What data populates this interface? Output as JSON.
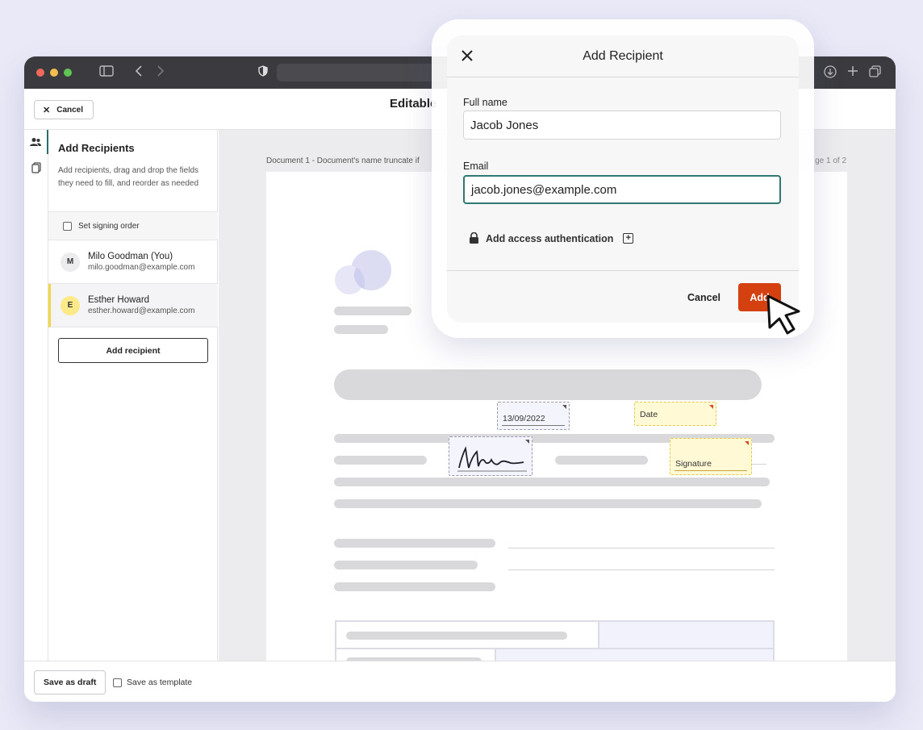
{
  "toolbar": {
    "cancel_label": "Cancel",
    "page_title": "Editable"
  },
  "sidebar": {
    "title": "Add Recipients",
    "description": "Add recipients, drag and drop the fields they need to fill, and reorder as needed",
    "signing_order_label": "Set signing order",
    "recipients": [
      {
        "initial": "M",
        "name": "Milo Goodman (You)",
        "email": "milo.goodman@example.com",
        "avatar_color": "#ececef"
      },
      {
        "initial": "E",
        "name": "Esther Howard",
        "email": "esther.howard@example.com",
        "avatar_color": "#fbe98a",
        "accent": "#f2d744"
      }
    ],
    "add_recipient_label": "Add recipient"
  },
  "canvas": {
    "doc_label": "Document 1 - Document's name truncate if",
    "page_count": "ge 1 of 2",
    "fields": {
      "date_value": "13/09/2022",
      "date_label": "Date",
      "signature_label": "Signature"
    }
  },
  "footer": {
    "save_draft_label": "Save as draft",
    "save_template_label": "Save as template"
  },
  "modal": {
    "title": "Add Recipient",
    "full_name_label": "Full name",
    "full_name_value": "Jacob Jones",
    "email_label": "Email",
    "email_value": "jacob.jones@example.com",
    "access_auth_label": "Add access authentication",
    "cancel_label": "Cancel",
    "add_label": "Add"
  },
  "colors": {
    "accent": "#d4400f",
    "focus": "#2e7a73",
    "signer_highlight": "#f2d744"
  },
  "icons": [
    "close-icon",
    "lock-icon",
    "plus-square-icon",
    "users-icon",
    "copy-icon",
    "cursor-icon",
    "sidebar-toggle-icon",
    "shield-icon",
    "download-icon",
    "new-tab-icon",
    "tabs-icon"
  ]
}
